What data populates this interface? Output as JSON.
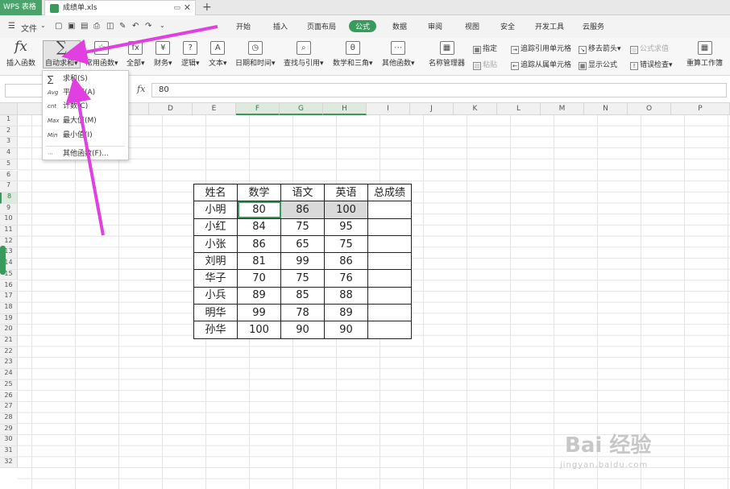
{
  "titlebar": {
    "app_name": "WPS 表格",
    "file_tab": "成绩单.xls",
    "new_tab": "+",
    "close": "✕",
    "monitor": "▭"
  },
  "menubar": {
    "file_label": "文件",
    "tabs": [
      "开始",
      "插入",
      "页面布局",
      "公式",
      "数据",
      "审阅",
      "视图",
      "安全",
      "开发工具",
      "云服务"
    ],
    "active_tab": "公式"
  },
  "ribbon": {
    "insert_function": "插入函数",
    "autosum": "自动求和",
    "common_functions": "常用函数",
    "all": "全部",
    "finance": "财务",
    "logic": "逻辑",
    "text": "文本",
    "datetime": "日期和时间",
    "lookup": "查找与引用",
    "math_trig": "数学和三角",
    "other_functions": "其他函数",
    "name_manager": "名称管理器",
    "specify": "指定",
    "paste": "粘贴",
    "trace_precedents": "追踪引用单元格",
    "trace_dependents": "追踪从属单元格",
    "remove_arrows": "移去箭头",
    "show_formulas": "显示公式",
    "formula_evaluate": "公式求值",
    "error_check": "错误检查",
    "recalculate": "重算工作簿"
  },
  "formula_bar": {
    "fx": "fx",
    "value": "80"
  },
  "columns": [
    "D",
    "E",
    "F",
    "G",
    "H",
    "I",
    "J",
    "K",
    "L",
    "M",
    "N",
    "O",
    "P"
  ],
  "rows": [
    "1",
    "2",
    "3",
    "4",
    "5",
    "6",
    "7",
    "8",
    "9",
    "10",
    "11",
    "12",
    "13",
    "14",
    "15",
    "16",
    "17",
    "18",
    "19",
    "20",
    "21",
    "22",
    "23",
    "24",
    "25",
    "26",
    "27",
    "28",
    "29",
    "30",
    "31",
    "32"
  ],
  "table": {
    "headers": [
      "姓名",
      "数学",
      "语文",
      "英语",
      "总成绩"
    ],
    "rows": [
      [
        "小明",
        "80",
        "86",
        "100",
        ""
      ],
      [
        "小红",
        "84",
        "75",
        "95",
        ""
      ],
      [
        "小张",
        "86",
        "65",
        "75",
        ""
      ],
      [
        "刘明",
        "81",
        "99",
        "86",
        ""
      ],
      [
        "华子",
        "70",
        "75",
        "76",
        ""
      ],
      [
        "小兵",
        "89",
        "85",
        "88",
        ""
      ],
      [
        "明华",
        "99",
        "78",
        "89",
        ""
      ],
      [
        "孙华",
        "100",
        "90",
        "90",
        ""
      ]
    ]
  },
  "dropdown": {
    "items": [
      {
        "icon": "∑",
        "label": "求和(S)"
      },
      {
        "icon": "Avg",
        "label": "平均值(A)"
      },
      {
        "icon": "cnt",
        "label": "计数(C)"
      },
      {
        "icon": "Max",
        "label": "最大值(M)"
      },
      {
        "icon": "Min",
        "label": "最小值(I)"
      },
      {
        "icon": "⋯",
        "label": "其他函数(F)..."
      }
    ]
  },
  "watermark": {
    "logo": "Bai 经验",
    "url": "jingyan.baidu.com"
  },
  "colors": {
    "accent": "#3a9a5c",
    "arrow": "#e040e0"
  }
}
